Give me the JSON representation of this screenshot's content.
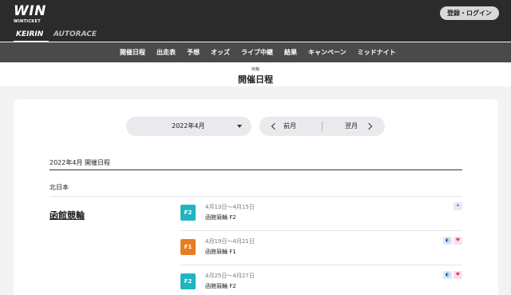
{
  "header": {
    "logo_main": "WIN",
    "logo_sub": "WINTICKET",
    "login_label": "登録・ログイン",
    "tabs": {
      "keirin": "KEIRIN",
      "autorace": "AUTORACE"
    }
  },
  "nav": [
    "開催日程",
    "出走表",
    "予想",
    "オッズ",
    "ライブ中継",
    "結果",
    "キャンペーン",
    "ミッドナイト"
  ],
  "page": {
    "category": "競輪",
    "title": "開催日程"
  },
  "controls": {
    "month": "2022年4月",
    "prev": "前月",
    "next": "翌月"
  },
  "schedule": {
    "heading": "2022年4月 開催日程",
    "region": "北日本",
    "venue": "函館競輪",
    "races": [
      {
        "grade": "F2",
        "dates": "4月13日～4月15日",
        "name": "函館競輪 F2"
      },
      {
        "grade": "F1",
        "dates": "4月19日～4月21日",
        "name": "函館競輪 F1"
      },
      {
        "grade": "F2",
        "dates": "4月25日～4月27日",
        "name": "函館競輪 F2"
      }
    ]
  },
  "icons": {
    "race1": [
      "star-badge-icon"
    ],
    "race2": [
      "night-badge-icon",
      "heart-badge-icon"
    ],
    "race3": [
      "night-badge-icon",
      "heart-badge-icon"
    ]
  },
  "colors": {
    "f2": "#1fb6c1",
    "f1": "#e67e22",
    "header": "#2b2b2b",
    "nav": "#4a4a4a"
  }
}
